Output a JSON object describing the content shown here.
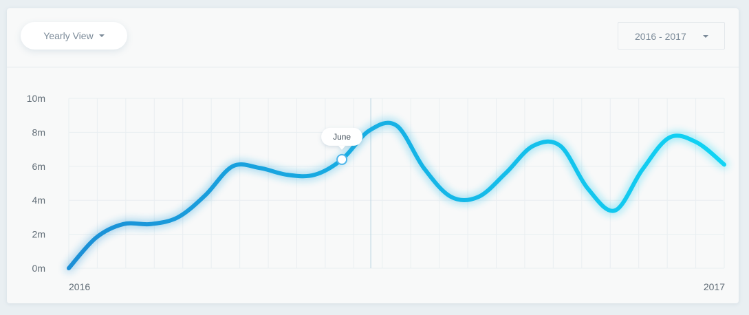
{
  "header": {
    "view_label": "Yearly View",
    "range_label": "2016 - 2017",
    "caret_icon": "chevron-down-icon"
  },
  "colors": {
    "line_start": "#1b8fd6",
    "line_end": "#10d4f4",
    "grid": "#e9eef1",
    "marker_line": "#b8d3e2"
  },
  "chart_data": {
    "type": "line",
    "title": "",
    "xlabel": "",
    "ylabel": "",
    "ylim": [
      0,
      10
    ],
    "y_ticks": [
      {
        "value": 0,
        "label": "0m"
      },
      {
        "value": 2,
        "label": "2m"
      },
      {
        "value": 4,
        "label": "4m"
      },
      {
        "value": 6,
        "label": "6m"
      },
      {
        "value": 8,
        "label": "8m"
      },
      {
        "value": 10,
        "label": "10m"
      }
    ],
    "x_labels": {
      "start": "2016",
      "end": "2017"
    },
    "grid": true,
    "series": [
      {
        "values": [
          0,
          1.8,
          2.6,
          2.6,
          3.0,
          4.3,
          6.0,
          5.9,
          5.5,
          5.5,
          6.4,
          8.1,
          8.4,
          5.9,
          4.2,
          4.2,
          5.6,
          7.2,
          7.2,
          4.7,
          3.4,
          5.8,
          7.7,
          7.4,
          6.1
        ]
      }
    ],
    "highlight": {
      "index": 10,
      "label": "June"
    }
  }
}
